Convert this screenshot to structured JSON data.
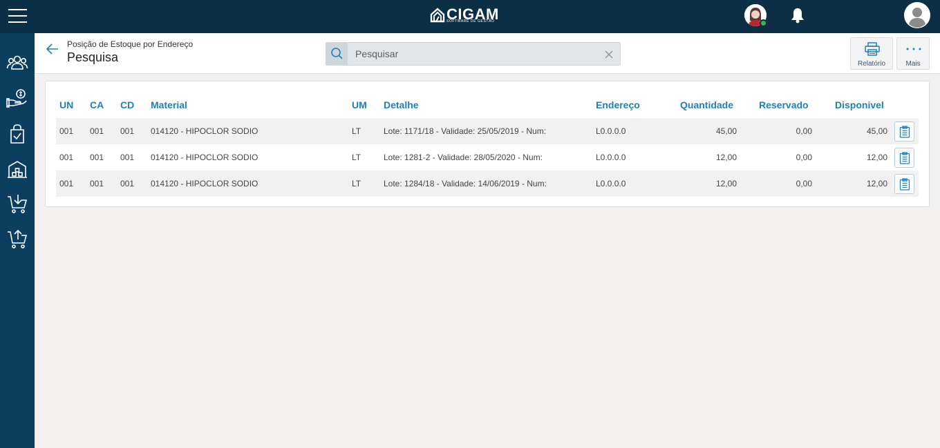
{
  "app": {
    "logo_text": "CIGAM",
    "logo_subtitle": "SOFTWARE DE GESTÃO"
  },
  "sidebar": {
    "items": [
      {
        "icon": "users-icon"
      },
      {
        "icon": "hand-money-icon"
      },
      {
        "icon": "shopping-bag-check-icon"
      },
      {
        "icon": "warehouse-icon"
      },
      {
        "icon": "cart-download-icon"
      },
      {
        "icon": "cart-upload-icon"
      }
    ]
  },
  "header": {
    "breadcrumb": "Posição de Estoque por Endereço",
    "title": "Pesquisa"
  },
  "search": {
    "placeholder": "Pesquisar",
    "value": ""
  },
  "toolbar": {
    "report_label": "Relatório",
    "more_label": "Mais"
  },
  "table": {
    "columns": {
      "un": "UN",
      "ca": "CA",
      "cd": "CD",
      "material": "Material",
      "um": "UM",
      "detalhe": "Detalhe",
      "endereco": "Endereço",
      "quantidade": "Quantidade",
      "reservado": "Reservado",
      "disponivel": "Disponivel"
    },
    "rows": [
      {
        "un": "001",
        "ca": "001",
        "cd": "001",
        "material": "014120 - HIPOCLOR SODIO",
        "um": "LT",
        "detalhe": "Lote: 1171/18 - Validade: 25/05/2019 - Num:",
        "endereco": "L0.0.0.0",
        "quantidade": "45,00",
        "reservado": "0,00",
        "disponivel": "45,00"
      },
      {
        "un": "001",
        "ca": "001",
        "cd": "001",
        "material": "014120 - HIPOCLOR SODIO",
        "um": "LT",
        "detalhe": "Lote: 1281-2 - Validade: 28/05/2020 - Num:",
        "endereco": "L0.0.0.0",
        "quantidade": "12,00",
        "reservado": "0,00",
        "disponivel": "12,00"
      },
      {
        "un": "001",
        "ca": "001",
        "cd": "001",
        "material": "014120 - HIPOCLOR SODIO",
        "um": "LT",
        "detalhe": "Lote: 1284/18 - Validade: 14/06/2019 - Num:",
        "endereco": "L0.0.0.0",
        "quantidade": "12,00",
        "reservado": "0,00",
        "disponivel": "12,00"
      }
    ]
  },
  "colors": {
    "topbar": "#0c2f45",
    "sidebar": "#0c3f5f",
    "accent": "#1e7fb8",
    "online": "#3fb24f"
  }
}
